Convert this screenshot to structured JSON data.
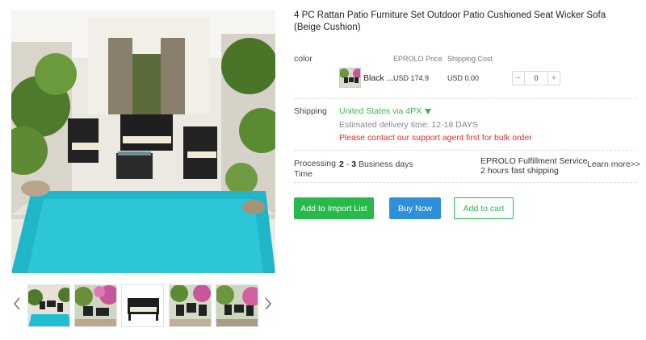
{
  "product": {
    "title": "4 PC Rattan Patio Furniture Set Outdoor Patio Cushioned Seat Wicker Sofa (Beige Cushion)"
  },
  "variants": {
    "label": "color",
    "col_price": "EPROLO Price",
    "col_shipping": "Shipping Cost",
    "row": {
      "name": "Black ...",
      "price": "USD 174.9",
      "shipping": "USD 0.00",
      "quantity": "0"
    }
  },
  "shipping": {
    "label": "Shipping",
    "method": "United States via 4PX",
    "delivery": "Estimated delivery time: 12-18 DAYS",
    "bulk_notice": "Please contact our support agent first for bulk order"
  },
  "processing": {
    "label_line1": "Processing",
    "label_line2": "Time",
    "days_from": "2",
    "days_sep": " - ",
    "days_to": "3",
    "days_suffix": " Business days",
    "fulfillment_line1": "EPROLO Fulfillment Service",
    "fulfillment_line2": "2 hours fast shipping",
    "learn_more": "Learn more>>"
  },
  "actions": {
    "import": "Add to Import List",
    "buy": "Buy Now",
    "cart": "Add to cart"
  },
  "gallery": {
    "thumbnail_count": 5,
    "selected_index": 0
  },
  "icons": {
    "prev": "chevron-left-icon",
    "next": "chevron-right-icon",
    "dropdown": "caret-down-icon",
    "minus": "minus-icon",
    "plus": "plus-icon"
  },
  "colors": {
    "green": "#27b94b",
    "blue": "#2f8fd8",
    "red": "#e0302c",
    "ship_green": "#3bb44a"
  }
}
